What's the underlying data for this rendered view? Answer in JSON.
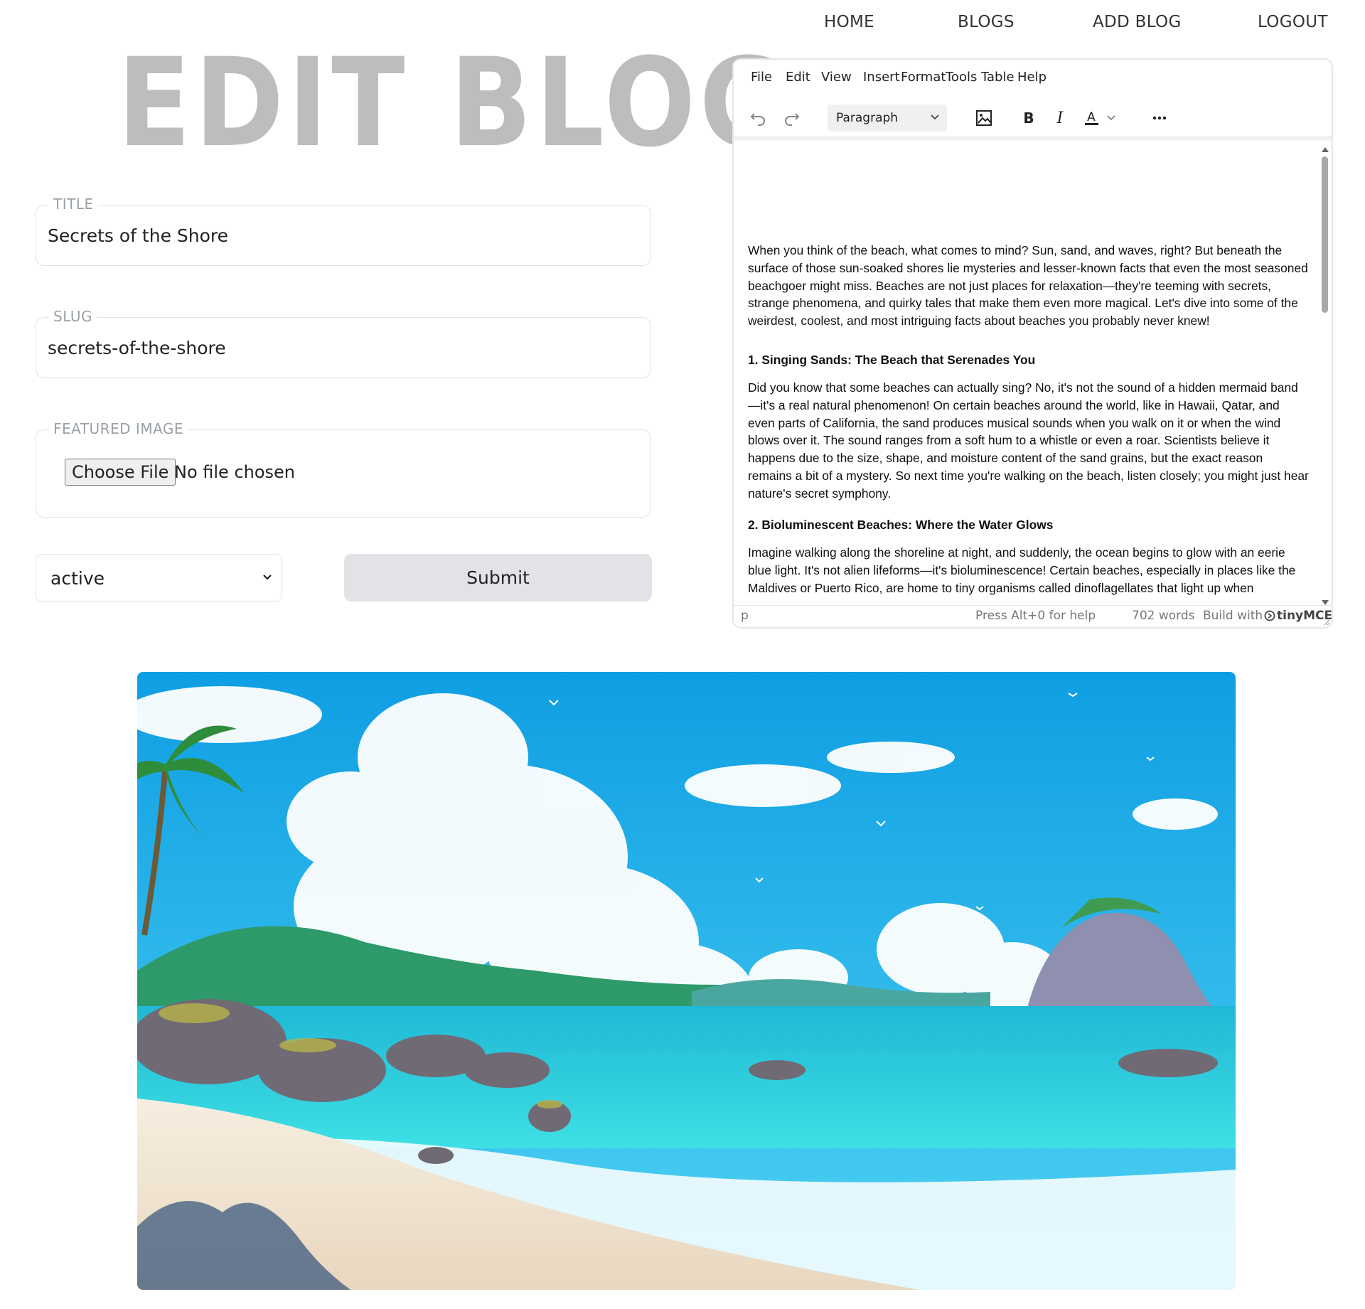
{
  "nav": {
    "home": "HOME",
    "blogs": "BLOGS",
    "add_blog": "ADD BLOG",
    "logout": "LOGOUT"
  },
  "page_title": "EDIT BLOG",
  "form": {
    "title_label": "TITLE",
    "title_value": "Secrets of the Shore",
    "slug_label": "SLUG",
    "slug_value": "secrets-of-the-shore",
    "image_label": "FEATURED IMAGE",
    "choose_file": "Choose File",
    "no_file": "No file chosen",
    "status_value": "active",
    "submit": "Submit"
  },
  "editor": {
    "menu": [
      "File",
      "Edit",
      "View",
      "Insert",
      "Format",
      "Tools",
      "Table",
      "Help"
    ],
    "block_format": "Paragraph",
    "content": [
      "When you think of the beach, what comes to mind? Sun, sand, and waves, right? But beneath the surface of those sun-soaked shores lie mysteries and lesser-known facts that even the most seasoned beachgoer might miss. Beaches are not just places for relaxation—they're teeming with secrets, strange phenomena, and quirky tales that make them even more magical. Let's dive into some of the weirdest, coolest, and most intriguing facts about beaches you probably never knew!",
      "1. Singing Sands: The Beach that Serenades You",
      "Did you know that some beaches can actually sing? No, it's not the sound of a hidden mermaid band—it's a real natural phenomenon! On certain beaches around the world, like in Hawaii, Qatar, and even parts of California, the sand produces musical sounds when you walk on it or when the wind blows over it. The sound ranges from a soft hum to a whistle or even a roar. Scientists believe it happens due to the size, shape, and moisture content of the sand grains, but the exact reason remains a bit of a mystery. So next time you're walking on the beach, listen closely; you might just hear nature's secret symphony.",
      "2. Bioluminescent Beaches: Where the Water Glows",
      "Imagine walking along the shoreline at night, and suddenly, the ocean begins to glow with an eerie blue light. It's not alien lifeforms—it's bioluminescence! Certain beaches, especially in places like the Maldives or Puerto Rico, are home to tiny organisms called dinoflagellates that light up when"
    ],
    "status_path": "p",
    "help_hint": "Press Alt+0 for help",
    "word_count": "702 words",
    "build_with": "Build with",
    "brand": "tinyMCE"
  },
  "colors": {
    "title_gray": "#bdbdbd",
    "submit_bg": "#e2e3e7",
    "sea": "#1ec8d8",
    "sky": "#16a8e6"
  }
}
